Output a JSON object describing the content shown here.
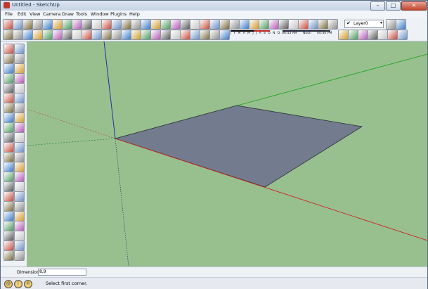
{
  "window": {
    "title": "Untitled - SketchUp",
    "minimize_glyph": "–",
    "maximize_glyph": "□",
    "close_glyph": "×"
  },
  "menubar": [
    "File",
    "Edit",
    "View",
    "Camera",
    "Draw",
    "Tools",
    "Window",
    "Plugins",
    "Help"
  ],
  "layers": {
    "current": "Layer0",
    "check": "✔",
    "arrow": "▾"
  },
  "shadow": {
    "months": "J F M A M J J A S O N D",
    "time_start": "06:43 AM",
    "time_mid": "Noon",
    "time_end": "04:46 PM"
  },
  "toolbar_icons": [
    "select-icon",
    "pencil-icon",
    "rectangle-icon",
    "circle-icon",
    "arc-icon",
    "make-component-icon",
    "eraser-icon",
    "paint-bucket-icon",
    "push-pull-icon",
    "move-icon",
    "rotate-icon",
    "offset-icon",
    "orbit-icon",
    "pan-icon",
    "zoom-icon",
    "zoom-extents-icon",
    "get-models-icon",
    "share-model-icon",
    "share-component-icon",
    "get-photo-texture-icon",
    "new-icon",
    "open-icon",
    "save-icon",
    "cut-icon",
    "copy-icon",
    "paste-icon",
    "erase-icon",
    "undo-icon",
    "redo-icon",
    "print-icon",
    "model-info-icon",
    "iso-view-icon",
    "top-view-icon",
    "front-view-icon",
    "right-view-icon",
    "back-view-icon",
    "left-view-icon",
    "xray-icon",
    "wireframe-icon",
    "hidden-line-icon",
    "shaded-icon",
    "shaded-textures-icon",
    "monochrome-icon",
    "shadow-settings-icon",
    "display-shadows-icon",
    "section-plane-icon",
    "display-section-planes-icon",
    "display-section-cuts-icon",
    "layer-manager-icon",
    "sandbox-icon",
    "3d-warehouse-icon"
  ],
  "dimensions": {
    "label": "Dimensions",
    "value": "8,9"
  },
  "status": {
    "geo_glyph": "@",
    "info_glyph": "i",
    "credits_glyph": "©",
    "text": "Select first corner."
  },
  "colors": {
    "viewport": "#98c08f",
    "face": "#737c8f",
    "x_axis": "#cc2222",
    "y_axis": "#23a623",
    "z_axis": "#1f2f9e"
  }
}
